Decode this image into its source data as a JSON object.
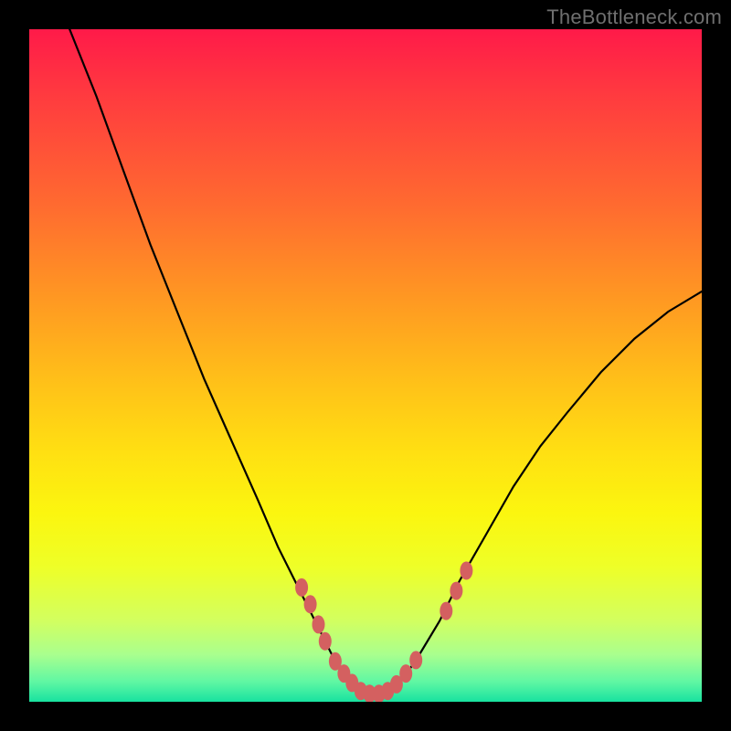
{
  "watermark": "TheBottleneck.com",
  "chart_data": {
    "type": "line",
    "title": "",
    "xlabel": "",
    "ylabel": "",
    "xlim": [
      0,
      100
    ],
    "ylim": [
      0,
      100
    ],
    "grid": false,
    "series": [
      {
        "name": "curve",
        "color": "#000000",
        "x": [
          6,
          10,
          14,
          18,
          22,
          26,
          30,
          34,
          37,
          40,
          43,
          45,
          47,
          49,
          50,
          52,
          54,
          56,
          58,
          61,
          64,
          68,
          72,
          76,
          80,
          85,
          90,
          95,
          100
        ],
        "y": [
          100,
          90,
          79,
          68,
          58,
          48,
          39,
          30,
          23,
          17,
          11,
          7,
          4,
          2,
          1,
          1,
          2,
          4,
          7,
          12,
          18,
          25,
          32,
          38,
          43,
          49,
          54,
          58,
          61
        ]
      }
    ],
    "markers": [
      {
        "name": "beads",
        "color": "#d46060",
        "points": [
          {
            "x": 40.5,
            "y": 17.0
          },
          {
            "x": 41.8,
            "y": 14.5
          },
          {
            "x": 43.0,
            "y": 11.5
          },
          {
            "x": 44.0,
            "y": 9.0
          },
          {
            "x": 45.5,
            "y": 6.0
          },
          {
            "x": 46.8,
            "y": 4.2
          },
          {
            "x": 48.0,
            "y": 2.8
          },
          {
            "x": 49.3,
            "y": 1.6
          },
          {
            "x": 50.6,
            "y": 1.2
          },
          {
            "x": 52.0,
            "y": 1.2
          },
          {
            "x": 53.3,
            "y": 1.6
          },
          {
            "x": 54.6,
            "y": 2.6
          },
          {
            "x": 56.0,
            "y": 4.2
          },
          {
            "x": 57.5,
            "y": 6.2
          },
          {
            "x": 62.0,
            "y": 13.5
          },
          {
            "x": 63.5,
            "y": 16.5
          },
          {
            "x": 65.0,
            "y": 19.5
          }
        ]
      }
    ],
    "background": {
      "type": "vertical-gradient",
      "stops": [
        {
          "pos": 0,
          "color": "#ff1a49"
        },
        {
          "pos": 50,
          "color": "#ffbf19"
        },
        {
          "pos": 80,
          "color": "#eeff28"
        },
        {
          "pos": 100,
          "color": "#18e2a0"
        }
      ]
    }
  }
}
